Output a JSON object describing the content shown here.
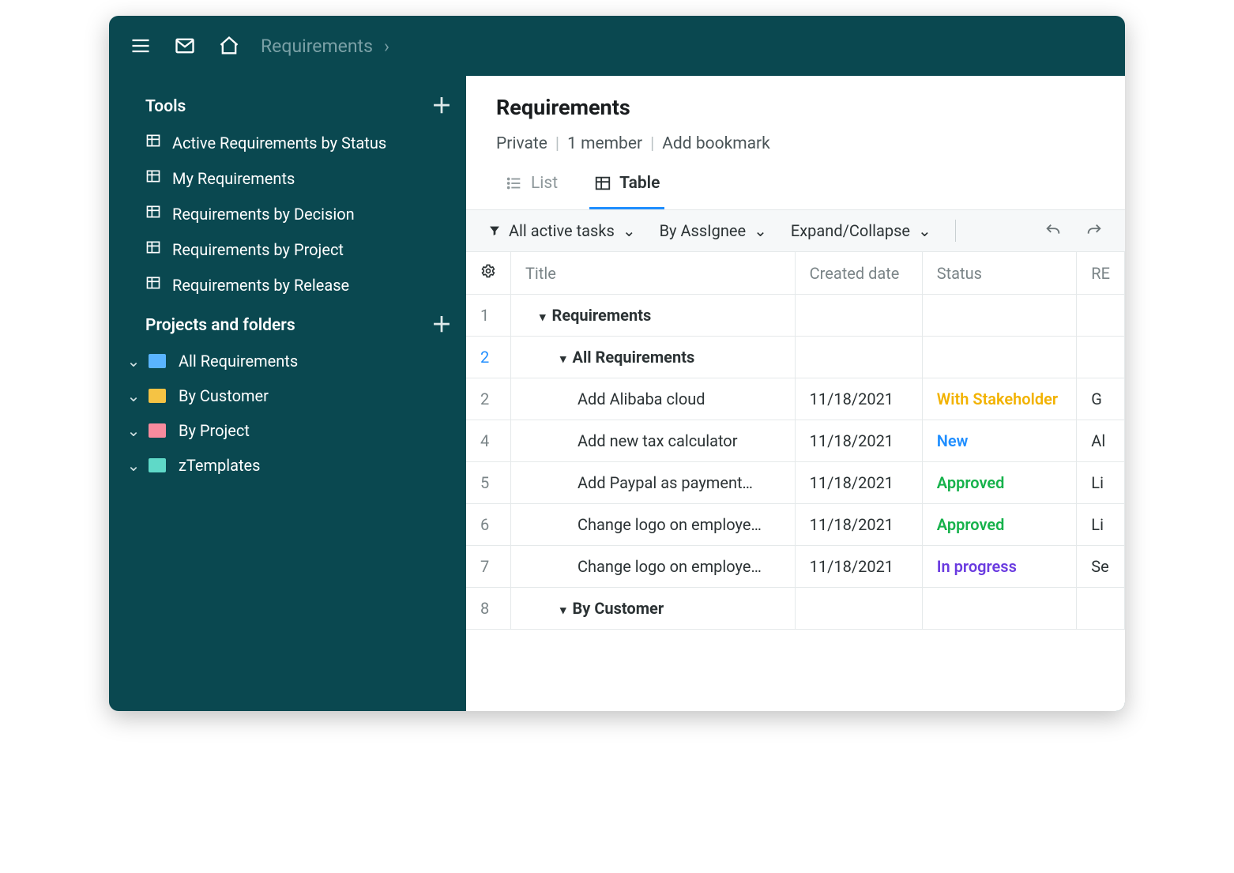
{
  "breadcrumb": {
    "title": "Requirements"
  },
  "sidebar": {
    "tools_label": "Tools",
    "tools": [
      {
        "label": "Active Requirements by Status"
      },
      {
        "label": "My Requirements"
      },
      {
        "label": "Requirements by Decision"
      },
      {
        "label": "Requirements by Project"
      },
      {
        "label": "Requirements by Release"
      }
    ],
    "projects_label": "Projects and folders",
    "folders": [
      {
        "label": "All Requirements",
        "color": "blue"
      },
      {
        "label": "By Customer",
        "color": "yellow"
      },
      {
        "label": "By Project",
        "color": "pink"
      },
      {
        "label": "zTemplates",
        "color": "teal"
      }
    ]
  },
  "main": {
    "title": "Requirements",
    "privacy": "Private",
    "members": "1 member",
    "bookmark": "Add bookmark",
    "tabs": {
      "list": "List",
      "table": "Table"
    },
    "toolbar": {
      "filter": "All active tasks",
      "group": "By AssIgnee",
      "expand": "Expand/Collapse"
    },
    "columns": {
      "title": "Title",
      "created": "Created date",
      "status": "Status",
      "extra": "RE"
    },
    "rows": [
      {
        "num": "1",
        "type": "group",
        "indent": 1,
        "title": "Requirements"
      },
      {
        "num": "2",
        "type": "group",
        "indent": 2,
        "title": "All Requirements",
        "numClass": "blue"
      },
      {
        "num": "2",
        "type": "task",
        "indent": 3,
        "title": "Add Alibaba cloud",
        "date": "11/18/2021",
        "status": "With Stakeholder",
        "statusClass": "status-with",
        "extra": "G"
      },
      {
        "num": "4",
        "type": "task",
        "indent": 3,
        "title": "Add new tax calculator",
        "date": "11/18/2021",
        "status": "New",
        "statusClass": "status-new",
        "extra": "Al"
      },
      {
        "num": "5",
        "type": "task",
        "indent": 3,
        "title": "Add Paypal as payment…",
        "date": "11/18/2021",
        "status": "Approved",
        "statusClass": "status-approved",
        "extra": "Li"
      },
      {
        "num": "6",
        "type": "task",
        "indent": 3,
        "title": "Change logo on employe…",
        "date": "11/18/2021",
        "status": "Approved",
        "statusClass": "status-approved",
        "extra": "Li"
      },
      {
        "num": "7",
        "type": "task",
        "indent": 3,
        "title": "Change logo on employe…",
        "date": "11/18/2021",
        "status": "In progress",
        "statusClass": "status-progress",
        "extra": "Se"
      },
      {
        "num": "8",
        "type": "group",
        "indent": 2,
        "title": "By Customer"
      }
    ]
  }
}
